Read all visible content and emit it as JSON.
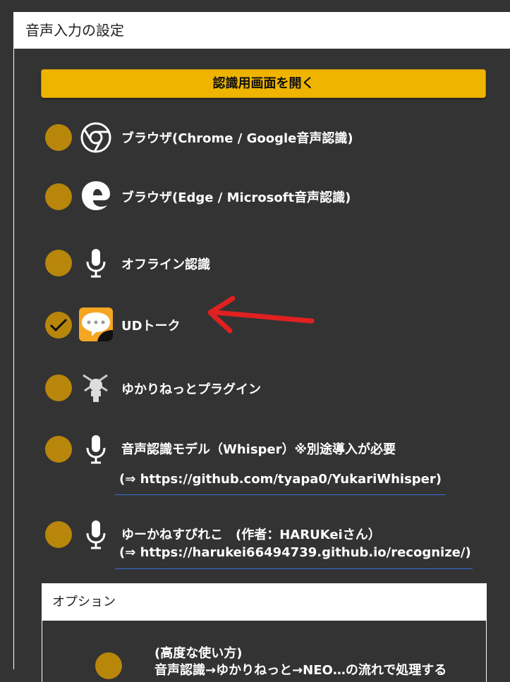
{
  "panel": {
    "title": "音声入力の設定",
    "open_button_label": "認識用画面を開く"
  },
  "options": [
    {
      "label": "ブラウザ(Chrome / Google音声認識)",
      "icon": "chrome-icon",
      "selected": false
    },
    {
      "label": "ブラウザ(Edge / Microsoft音声認識)",
      "icon": "edge-icon",
      "selected": false
    },
    {
      "label": "オフライン認識",
      "icon": "microphone-icon",
      "selected": false
    },
    {
      "label": "UDトーク",
      "icon": "udtalk-icon",
      "selected": true
    },
    {
      "label": "ゆかりねっとプラグイン",
      "icon": "yukarinette-plugin-icon",
      "selected": false
    },
    {
      "label": "音声認識モデル（Whisper）※別途導入が必要",
      "sub": "(⇒ https://github.com/tyapa0/YukariWhisper)",
      "icon": "microphone-icon",
      "selected": false
    },
    {
      "label": "ゆーかねすぴれこ　(作者：HARUKeiさん）",
      "sub": "(⇒ https://harukei66494739.github.io/recognize/)",
      "icon": "microphone-icon",
      "selected": false
    }
  ],
  "options_section": {
    "title": "オプション",
    "advanced_line1": "(高度な使い方)",
    "advanced_line2": "音声認識→ゆかりねっと→NEO…の流れで処理する"
  },
  "colors": {
    "background": "#333333",
    "button": "#efb400",
    "radio": "#b8860b",
    "link_underline": "#3a6fd8",
    "annotation_arrow": "#e02020"
  }
}
